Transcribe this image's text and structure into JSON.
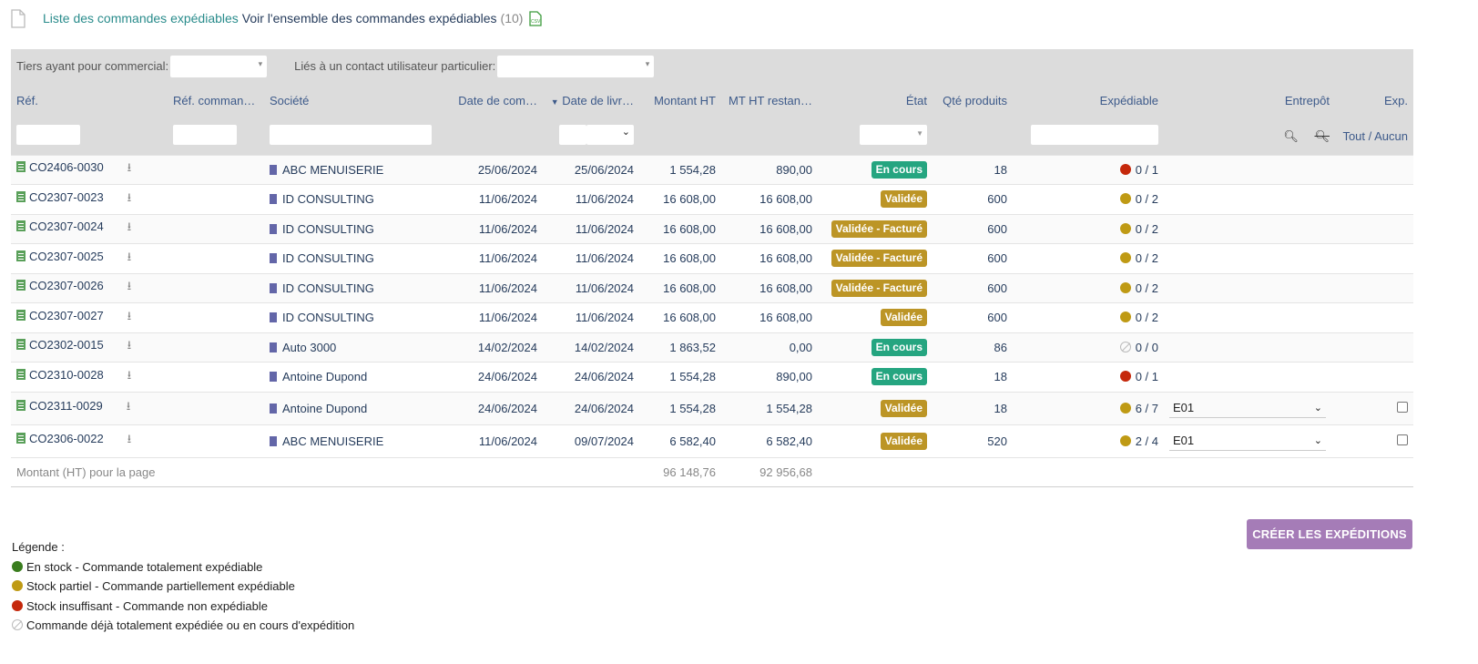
{
  "header": {
    "title_link": "Liste des commandes expédiables",
    "title_sub": "Voir l'ensemble des commandes expédiables",
    "count": "(10)"
  },
  "filterbar": {
    "commercial_label": "Tiers ayant pour commercial:",
    "contact_label": "Liés à un contact utilisateur particulier:"
  },
  "columns": {
    "ref": "Réf.",
    "ref_client": "Réf. comman…",
    "societe": "Société",
    "date_commande": "Date de com…",
    "date_livraison": "Date de livr…",
    "montant_ht": "Montant HT",
    "mt_restant": "MT HT restan…",
    "etat": "État",
    "qte": "Qté produits",
    "expediable": "Expédiable",
    "entrepot": "Entrepôt",
    "exp": "Exp."
  },
  "tout_aucun": "Tout / Aucun",
  "rows": [
    {
      "ref": "CO2406-0030",
      "societe": "ABC MENUISERIE",
      "date_cmd": "25/06/2024",
      "date_liv": "25/06/2024",
      "montant": "1 554,28",
      "restant": "890,00",
      "etat": "En cours",
      "qte": "18",
      "exped": "0 / 1"
    },
    {
      "ref": "CO2307-0023",
      "societe": "ID CONSULTING",
      "date_cmd": "11/06/2024",
      "date_liv": "11/06/2024",
      "montant": "16 608,00",
      "restant": "16 608,00",
      "etat": "Validée",
      "qte": "600",
      "exped": "0 / 2"
    },
    {
      "ref": "CO2307-0024",
      "societe": "ID CONSULTING",
      "date_cmd": "11/06/2024",
      "date_liv": "11/06/2024",
      "montant": "16 608,00",
      "restant": "16 608,00",
      "etat": "Validée - Facturé",
      "qte": "600",
      "exped": "0 / 2"
    },
    {
      "ref": "CO2307-0025",
      "societe": "ID CONSULTING",
      "date_cmd": "11/06/2024",
      "date_liv": "11/06/2024",
      "montant": "16 608,00",
      "restant": "16 608,00",
      "etat": "Validée - Facturé",
      "qte": "600",
      "exped": "0 / 2"
    },
    {
      "ref": "CO2307-0026",
      "societe": "ID CONSULTING",
      "date_cmd": "11/06/2024",
      "date_liv": "11/06/2024",
      "montant": "16 608,00",
      "restant": "16 608,00",
      "etat": "Validée - Facturé",
      "qte": "600",
      "exped": "0 / 2"
    },
    {
      "ref": "CO2307-0027",
      "societe": "ID CONSULTING",
      "date_cmd": "11/06/2024",
      "date_liv": "11/06/2024",
      "montant": "16 608,00",
      "restant": "16 608,00",
      "etat": "Validée",
      "qte": "600",
      "exped": "0 / 2"
    },
    {
      "ref": "CO2302-0015",
      "societe": "Auto 3000",
      "date_cmd": "14/02/2024",
      "date_liv": "14/02/2024",
      "montant": "1 863,52",
      "restant": "0,00",
      "etat": "En cours",
      "qte": "86",
      "exped": "0 / 0"
    },
    {
      "ref": "CO2310-0028",
      "societe": "Antoine Dupond",
      "date_cmd": "24/06/2024",
      "date_liv": "24/06/2024",
      "montant": "1 554,28",
      "restant": "890,00",
      "etat": "En cours",
      "qte": "18",
      "exped": "0 / 1"
    },
    {
      "ref": "CO2311-0029",
      "societe": "Antoine Dupond",
      "date_cmd": "24/06/2024",
      "date_liv": "24/06/2024",
      "montant": "1 554,28",
      "restant": "1 554,28",
      "etat": "Validée",
      "qte": "18",
      "exped": "6 / 7",
      "entrepot": "E01"
    },
    {
      "ref": "CO2306-0022",
      "societe": "ABC MENUISERIE",
      "date_cmd": "11/06/2024",
      "date_liv": "09/07/2024",
      "montant": "6 582,40",
      "restant": "6 582,40",
      "etat": "Validée",
      "qte": "520",
      "exped": "2 / 4",
      "entrepot": "E01"
    }
  ],
  "footer": {
    "label": "Montant (HT) pour la page",
    "montant_total": "96 148,76",
    "restant_total": "92 956,68"
  },
  "create_button": "CRÉER LES EXPÉDITIONS",
  "legend": {
    "title": "Légende :",
    "green": "En stock - Commande totalement expédiable",
    "yellow": "Stock partiel - Commande partiellement expédiable",
    "red": "Stock insuffisant - Commande non expédiable",
    "none": "Commande déjà totalement expédiée ou en cours d'expédition"
  },
  "colors": {
    "en_cours": "#25a580",
    "validee": "#bc9526",
    "create_button": "#a57cb7",
    "title_link": "#2a8c8c"
  }
}
